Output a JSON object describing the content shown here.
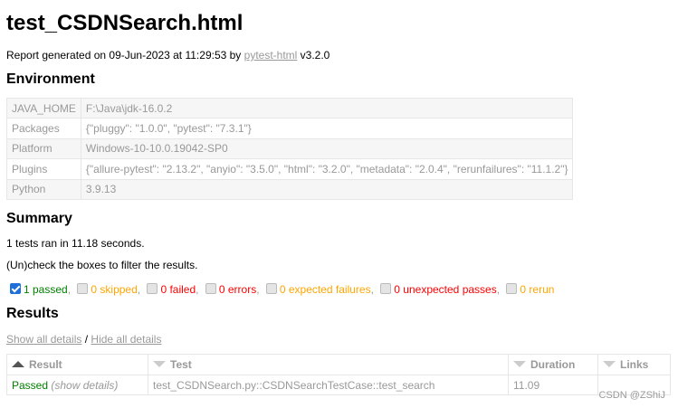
{
  "title": "test_CSDNSearch.html",
  "generated": {
    "prefix": "Report generated on 09-Jun-2023 at 11:29:53 by ",
    "link": "pytest-html",
    "suffix": " v3.2.0"
  },
  "environment": {
    "heading": "Environment",
    "rows": [
      {
        "key": "JAVA_HOME",
        "value": "F:\\Java\\jdk-16.0.2"
      },
      {
        "key": "Packages",
        "value": "{\"pluggy\": \"1.0.0\", \"pytest\": \"7.3.1\"}"
      },
      {
        "key": "Platform",
        "value": "Windows-10-10.0.19042-SP0"
      },
      {
        "key": "Plugins",
        "value": "{\"allure-pytest\": \"2.13.2\", \"anyio\": \"3.5.0\", \"html\": \"3.2.0\", \"metadata\": \"2.0.4\", \"rerunfailures\": \"11.1.2\"}"
      },
      {
        "key": "Python",
        "value": "3.9.13"
      }
    ]
  },
  "summary": {
    "heading": "Summary",
    "ran": "1 tests ran in 11.18 seconds.",
    "instruction": "(Un)check the boxes to filter the results.",
    "filters": [
      {
        "label": "1 passed",
        "checked": true
      },
      {
        "label": "0 skipped",
        "checked": false
      },
      {
        "label": "0 failed",
        "checked": false
      },
      {
        "label": "0 errors",
        "checked": false
      },
      {
        "label": "0 expected failures",
        "checked": false
      },
      {
        "label": "0 unexpected passes",
        "checked": false
      },
      {
        "label": "0 rerun",
        "checked": false
      }
    ],
    "separator": ","
  },
  "results": {
    "heading": "Results",
    "show_all": "Show all details",
    "slash": " / ",
    "hide_all": "Hide all details",
    "columns": {
      "result": "Result",
      "test": "Test",
      "duration": "Duration",
      "links": "Links"
    },
    "rows": [
      {
        "result": "Passed",
        "show_details": "(show details)",
        "test": "test_CSDNSearch.py::CSDNSearchTestCase::test_search",
        "duration": "11.09",
        "links": ""
      }
    ]
  },
  "watermark": "CSDN @ZShiJ",
  "colors": {
    "passed": "#008000",
    "failed": "#ff0000",
    "skipped": "#ffa500",
    "muted": "#999999",
    "checkbox": "#1e6fd9"
  }
}
